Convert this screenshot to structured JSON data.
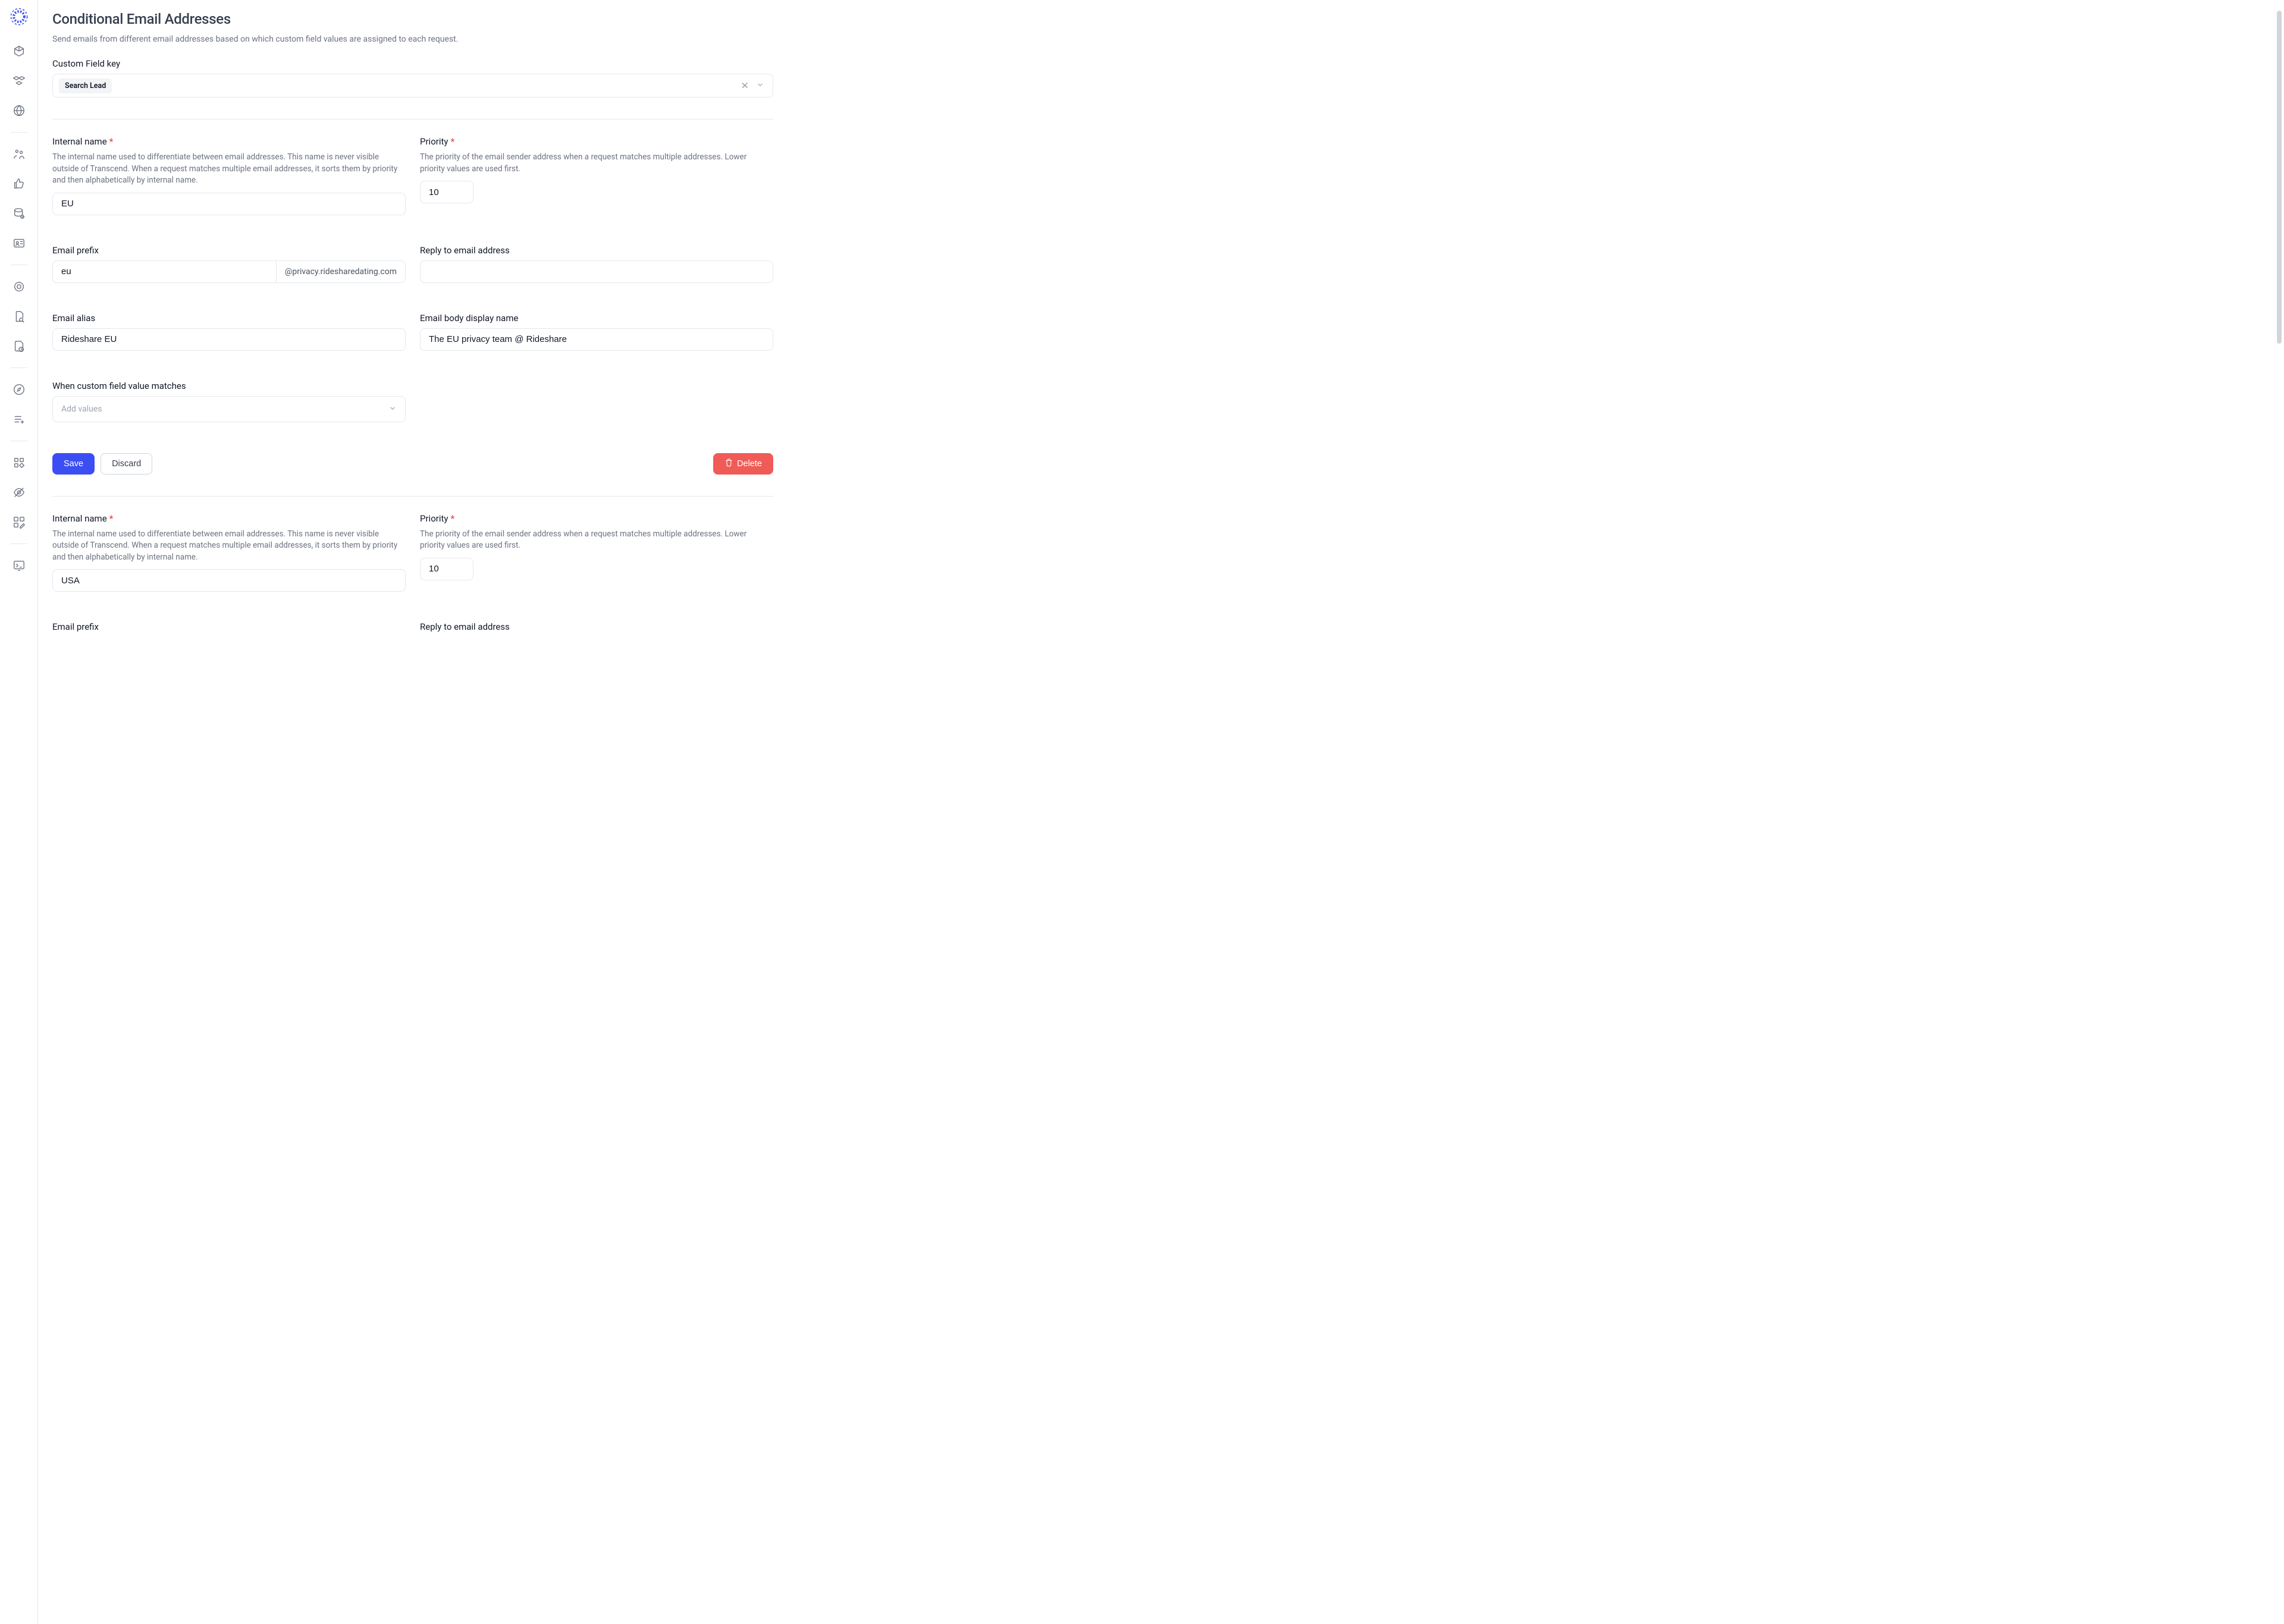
{
  "page": {
    "title": "Conditional Email Addresses",
    "description": "Send emails from different email addresses based on which custom field values are assigned to each request."
  },
  "customFieldKey": {
    "label": "Custom Field key",
    "chip": "Search Lead"
  },
  "labels": {
    "internalName": "Internal name",
    "internalNameHelp": "The internal name used to differentiate between email addresses. This name is never visible outside of Transcend. When a request matches multiple email addresses, it sorts them by priority and then alphabetically by internal name.",
    "priority": "Priority",
    "priorityHelp": "The priority of the email sender address when a request matches multiple addresses. Lower priority values are used first.",
    "emailPrefix": "Email prefix",
    "emailSuffix": "@privacy.ridesharedating.com",
    "replyTo": "Reply to email address",
    "emailAlias": "Email alias",
    "bodyDisplay": "Email body display name",
    "matchesLabel": "When custom field value matches",
    "matchesPlaceholder": "Add values",
    "save": "Save",
    "discard": "Discard",
    "delete": "Delete"
  },
  "entries": [
    {
      "internalName": "EU",
      "priority": "10",
      "prefix": "eu",
      "replyTo": "",
      "alias": "Rideshare EU",
      "bodyDisplay": "The EU privacy team @ Rideshare"
    },
    {
      "internalName": "USA",
      "priority": "10",
      "prefix": "",
      "replyTo": "",
      "alias": "",
      "bodyDisplay": ""
    }
  ]
}
